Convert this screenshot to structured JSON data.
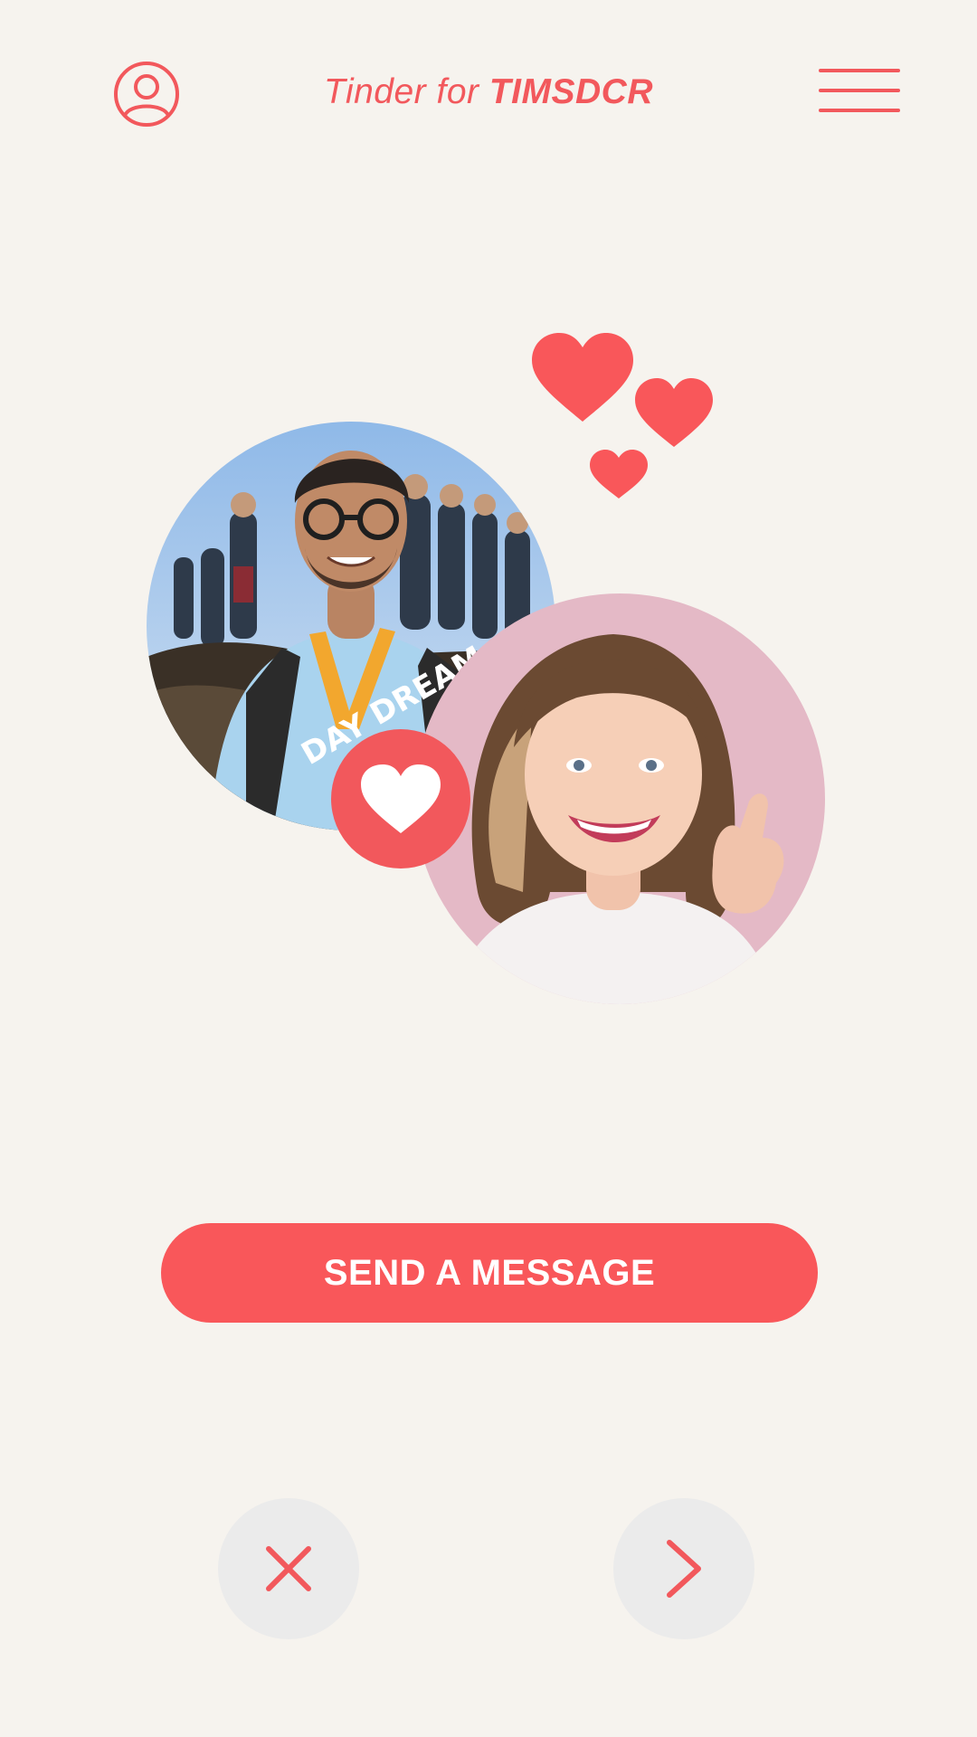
{
  "header": {
    "title_prefix": "Tinder for ",
    "title_brand": "TIMSDCR",
    "profile_icon": "user-circle-icon",
    "menu_icon": "hamburger-menu-icon"
  },
  "match": {
    "user_photo_alt": "Your profile photo",
    "match_photo_alt": "Match profile photo",
    "badge_icon": "heart-icon",
    "decor_icon": "hearts-icon"
  },
  "actions": {
    "send_message_label": "SEND A MESSAGE",
    "dismiss_icon": "close-icon",
    "next_icon": "chevron-right-icon"
  },
  "colors": {
    "accent": "#f2585c",
    "background": "#f6f3ee",
    "button_gray": "#ebebeb"
  }
}
